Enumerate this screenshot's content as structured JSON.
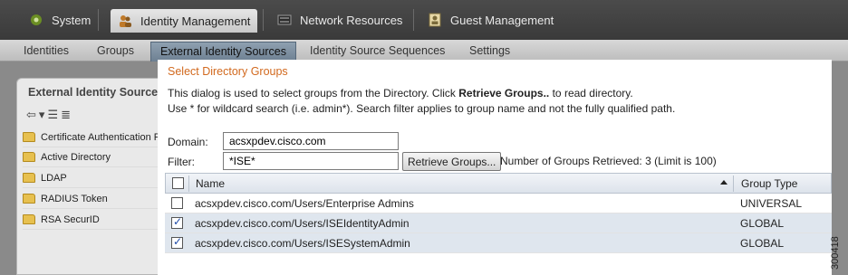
{
  "top_nav": {
    "items": [
      {
        "label": "System",
        "icon": "system-icon",
        "active": false
      },
      {
        "label": "Identity Management",
        "icon": "users-icon",
        "active": true
      },
      {
        "label": "Network Resources",
        "icon": "network-icon",
        "active": false
      },
      {
        "label": "Guest Management",
        "icon": "guest-icon",
        "active": false
      }
    ]
  },
  "sub_nav": {
    "items": [
      {
        "label": "Identities",
        "active": false
      },
      {
        "label": "Groups",
        "active": false
      },
      {
        "label": "External Identity Sources",
        "active": true
      },
      {
        "label": "Identity Source Sequences",
        "active": false
      },
      {
        "label": "Settings",
        "active": false
      }
    ]
  },
  "left_panel": {
    "title": "External Identity Sources",
    "items": [
      {
        "label": "Certificate Authentication Profile"
      },
      {
        "label": "Active Directory"
      },
      {
        "label": "LDAP"
      },
      {
        "label": "RADIUS Token"
      },
      {
        "label": "RSA SecurID"
      }
    ]
  },
  "dialog": {
    "title": "Select Directory Groups",
    "desc_line1_pre": "This dialog is used to select groups from the Directory. Click ",
    "desc_line1_bold": "Retrieve Groups..",
    "desc_line1_post": " to read directory.",
    "desc_line2": "Use * for wildcard search (i.e. admin*). Search filter applies to group name and not the fully qualified path.",
    "domain_label": "Domain:",
    "domain_value": "acsxpdev.cisco.com",
    "filter_label": "Filter:",
    "filter_value": "*ISE*",
    "retrieve_button": "Retrieve Groups...",
    "count_text": "Number of Groups Retrieved: 3 (Limit is 100)",
    "table": {
      "col_name": "Name",
      "col_type": "Group Type",
      "rows": [
        {
          "name": "acsxpdev.cisco.com/Users/Enterprise Admins",
          "type": "UNIVERSAL",
          "checked": false
        },
        {
          "name": "acsxpdev.cisco.com/Users/ISEIdentityAdmin",
          "type": "GLOBAL",
          "checked": true
        },
        {
          "name": "acsxpdev.cisco.com/Users/ISESystemAdmin",
          "type": "GLOBAL",
          "checked": true
        }
      ]
    }
  },
  "figure_code": "300418",
  "colors": {
    "dialog_title": "#d2691e",
    "selected_row": "#dfe6ee",
    "active_subnav": "#6d8092"
  }
}
